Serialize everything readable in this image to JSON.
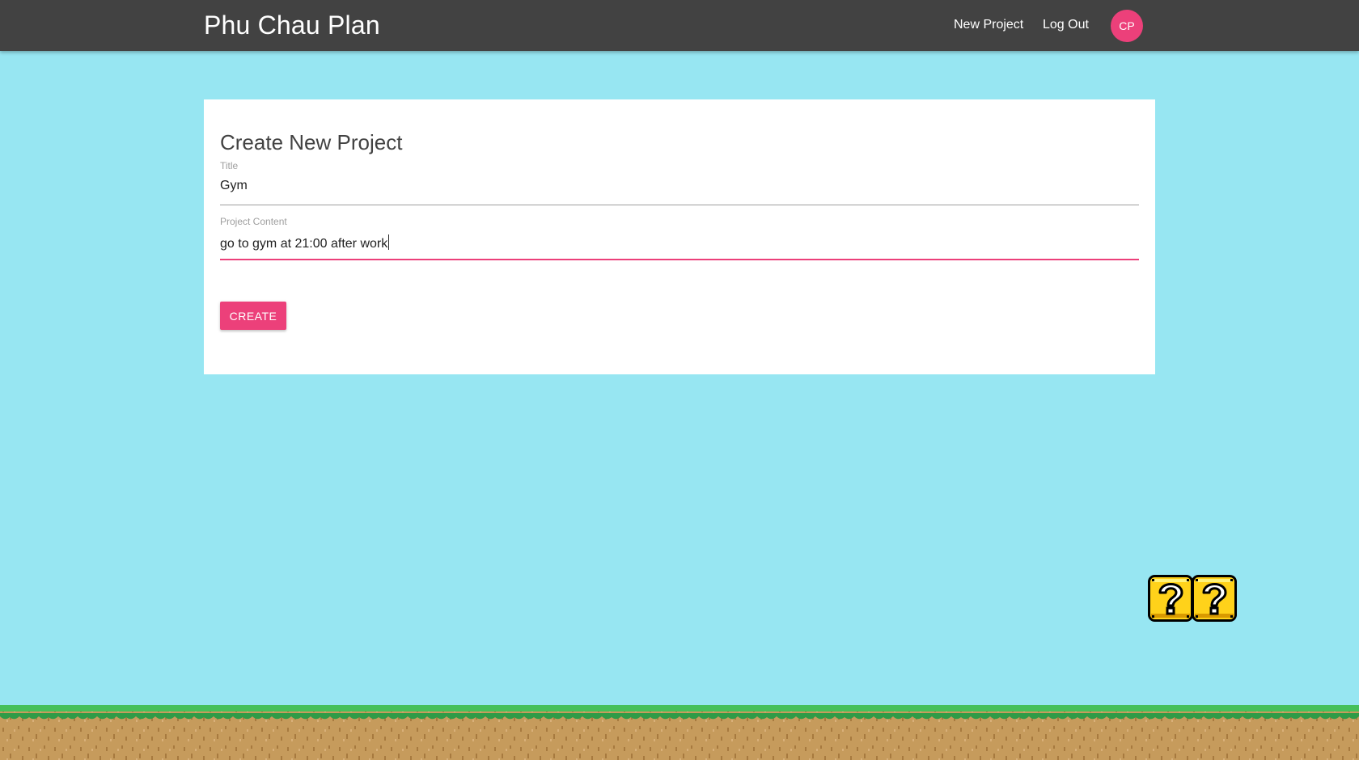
{
  "header": {
    "brand": "Phu Chau Plan",
    "nav": {
      "new_project": "New Project",
      "log_out": "Log Out"
    },
    "avatar_initials": "CP"
  },
  "form": {
    "heading": "Create New Project",
    "title_field": {
      "label": "Title",
      "value": "Gym"
    },
    "content_field": {
      "label": "Project Content",
      "value": "go to gym at 21:00 after work"
    },
    "submit_label": "CREATE"
  },
  "decorations": {
    "question_block_icon": "question-block-icon",
    "ground_icon": "grass-ground-icon"
  },
  "colors": {
    "background": "#97e6f2",
    "navbar": "#424242",
    "accent": "#ec407a",
    "card": "#ffffff",
    "input_underline": "#9e9e9e"
  }
}
